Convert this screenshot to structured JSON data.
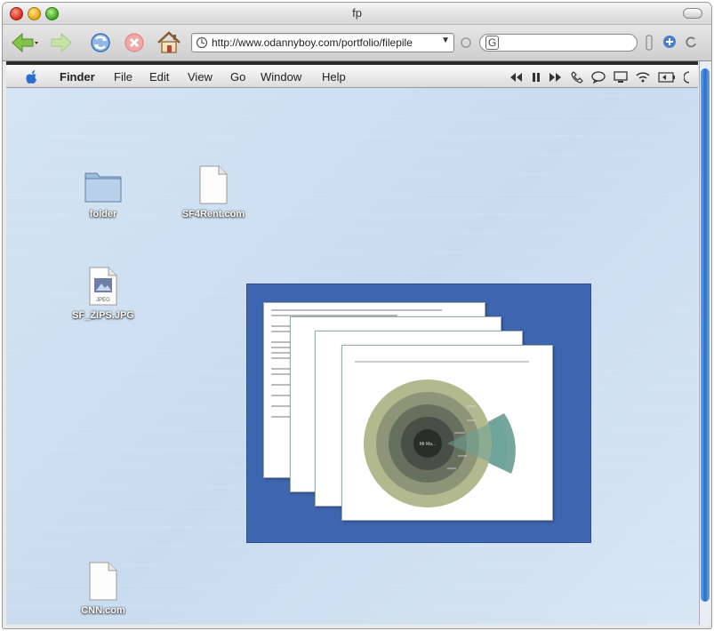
{
  "window": {
    "title": "fp"
  },
  "toolbar": {
    "url": "http://www.odannyboy.com/portfolio/filepile",
    "icons": [
      "back-arrow-icon",
      "forward-arrow-icon",
      "reload-icon",
      "stop-icon",
      "home-icon"
    ]
  },
  "menubar": {
    "items": [
      "Finder",
      "File",
      "Edit",
      "View",
      "Go",
      "Window",
      "Help"
    ]
  },
  "desktop": {
    "icons": [
      {
        "label": "folder",
        "type": "folder"
      },
      {
        "label": "SF4Rent.com",
        "type": "document"
      },
      {
        "label": "SF_ZIPS.JPG",
        "type": "jpeg"
      },
      {
        "label": "CNN.com",
        "type": "document"
      }
    ],
    "jpg_badge": "JPEG"
  },
  "preview": {
    "chart_center_label": "Mr Ma..."
  },
  "colors": {
    "desktop": "#cfe0f1",
    "preview_bg": "#3f66b0",
    "scroll_thumb": "#2a6fcd"
  }
}
